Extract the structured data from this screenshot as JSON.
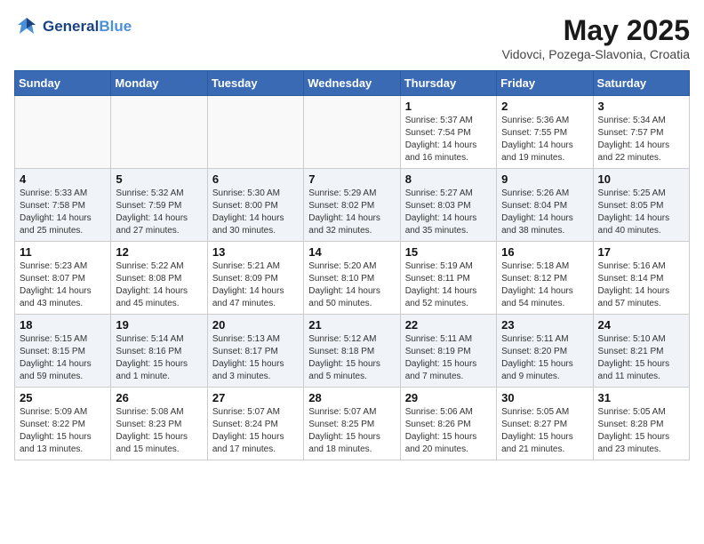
{
  "header": {
    "logo_line1": "General",
    "logo_line2": "Blue",
    "month_year": "May 2025",
    "location": "Vidovci, Pozega-Slavonia, Croatia"
  },
  "days_of_week": [
    "Sunday",
    "Monday",
    "Tuesday",
    "Wednesday",
    "Thursday",
    "Friday",
    "Saturday"
  ],
  "weeks": [
    [
      {
        "day": "",
        "info": ""
      },
      {
        "day": "",
        "info": ""
      },
      {
        "day": "",
        "info": ""
      },
      {
        "day": "",
        "info": ""
      },
      {
        "day": "1",
        "info": "Sunrise: 5:37 AM\nSunset: 7:54 PM\nDaylight: 14 hours\nand 16 minutes."
      },
      {
        "day": "2",
        "info": "Sunrise: 5:36 AM\nSunset: 7:55 PM\nDaylight: 14 hours\nand 19 minutes."
      },
      {
        "day": "3",
        "info": "Sunrise: 5:34 AM\nSunset: 7:57 PM\nDaylight: 14 hours\nand 22 minutes."
      }
    ],
    [
      {
        "day": "4",
        "info": "Sunrise: 5:33 AM\nSunset: 7:58 PM\nDaylight: 14 hours\nand 25 minutes."
      },
      {
        "day": "5",
        "info": "Sunrise: 5:32 AM\nSunset: 7:59 PM\nDaylight: 14 hours\nand 27 minutes."
      },
      {
        "day": "6",
        "info": "Sunrise: 5:30 AM\nSunset: 8:00 PM\nDaylight: 14 hours\nand 30 minutes."
      },
      {
        "day": "7",
        "info": "Sunrise: 5:29 AM\nSunset: 8:02 PM\nDaylight: 14 hours\nand 32 minutes."
      },
      {
        "day": "8",
        "info": "Sunrise: 5:27 AM\nSunset: 8:03 PM\nDaylight: 14 hours\nand 35 minutes."
      },
      {
        "day": "9",
        "info": "Sunrise: 5:26 AM\nSunset: 8:04 PM\nDaylight: 14 hours\nand 38 minutes."
      },
      {
        "day": "10",
        "info": "Sunrise: 5:25 AM\nSunset: 8:05 PM\nDaylight: 14 hours\nand 40 minutes."
      }
    ],
    [
      {
        "day": "11",
        "info": "Sunrise: 5:23 AM\nSunset: 8:07 PM\nDaylight: 14 hours\nand 43 minutes."
      },
      {
        "day": "12",
        "info": "Sunrise: 5:22 AM\nSunset: 8:08 PM\nDaylight: 14 hours\nand 45 minutes."
      },
      {
        "day": "13",
        "info": "Sunrise: 5:21 AM\nSunset: 8:09 PM\nDaylight: 14 hours\nand 47 minutes."
      },
      {
        "day": "14",
        "info": "Sunrise: 5:20 AM\nSunset: 8:10 PM\nDaylight: 14 hours\nand 50 minutes."
      },
      {
        "day": "15",
        "info": "Sunrise: 5:19 AM\nSunset: 8:11 PM\nDaylight: 14 hours\nand 52 minutes."
      },
      {
        "day": "16",
        "info": "Sunrise: 5:18 AM\nSunset: 8:12 PM\nDaylight: 14 hours\nand 54 minutes."
      },
      {
        "day": "17",
        "info": "Sunrise: 5:16 AM\nSunset: 8:14 PM\nDaylight: 14 hours\nand 57 minutes."
      }
    ],
    [
      {
        "day": "18",
        "info": "Sunrise: 5:15 AM\nSunset: 8:15 PM\nDaylight: 14 hours\nand 59 minutes."
      },
      {
        "day": "19",
        "info": "Sunrise: 5:14 AM\nSunset: 8:16 PM\nDaylight: 15 hours\nand 1 minute."
      },
      {
        "day": "20",
        "info": "Sunrise: 5:13 AM\nSunset: 8:17 PM\nDaylight: 15 hours\nand 3 minutes."
      },
      {
        "day": "21",
        "info": "Sunrise: 5:12 AM\nSunset: 8:18 PM\nDaylight: 15 hours\nand 5 minutes."
      },
      {
        "day": "22",
        "info": "Sunrise: 5:11 AM\nSunset: 8:19 PM\nDaylight: 15 hours\nand 7 minutes."
      },
      {
        "day": "23",
        "info": "Sunrise: 5:11 AM\nSunset: 8:20 PM\nDaylight: 15 hours\nand 9 minutes."
      },
      {
        "day": "24",
        "info": "Sunrise: 5:10 AM\nSunset: 8:21 PM\nDaylight: 15 hours\nand 11 minutes."
      }
    ],
    [
      {
        "day": "25",
        "info": "Sunrise: 5:09 AM\nSunset: 8:22 PM\nDaylight: 15 hours\nand 13 minutes."
      },
      {
        "day": "26",
        "info": "Sunrise: 5:08 AM\nSunset: 8:23 PM\nDaylight: 15 hours\nand 15 minutes."
      },
      {
        "day": "27",
        "info": "Sunrise: 5:07 AM\nSunset: 8:24 PM\nDaylight: 15 hours\nand 17 minutes."
      },
      {
        "day": "28",
        "info": "Sunrise: 5:07 AM\nSunset: 8:25 PM\nDaylight: 15 hours\nand 18 minutes."
      },
      {
        "day": "29",
        "info": "Sunrise: 5:06 AM\nSunset: 8:26 PM\nDaylight: 15 hours\nand 20 minutes."
      },
      {
        "day": "30",
        "info": "Sunrise: 5:05 AM\nSunset: 8:27 PM\nDaylight: 15 hours\nand 21 minutes."
      },
      {
        "day": "31",
        "info": "Sunrise: 5:05 AM\nSunset: 8:28 PM\nDaylight: 15 hours\nand 23 minutes."
      }
    ]
  ]
}
